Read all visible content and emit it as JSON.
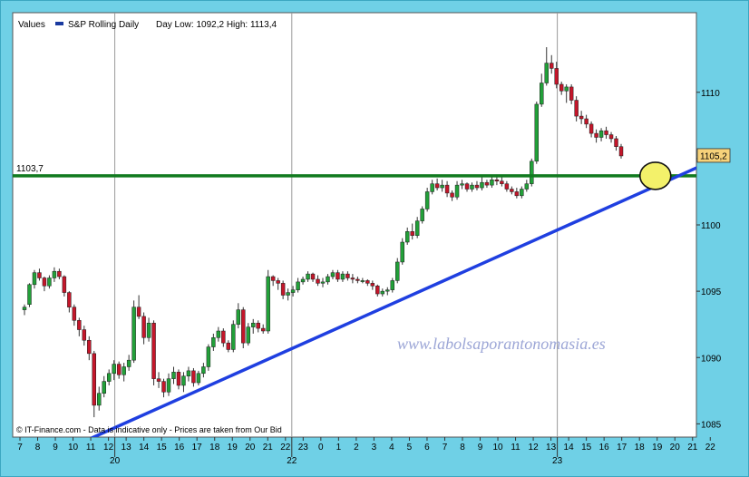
{
  "legend": {
    "values_label": "Values",
    "series_label": "S&P Rolling Daily",
    "range_text": "Day Low: 1092,2 High: 1113,4"
  },
  "footer": {
    "text": "© IT-Finance.com - Data is indicative only - Prices are taken from Our Bid"
  },
  "watermark": "www.labolsaporantonomasia.es",
  "colors": {
    "frame": "#6fd0e6",
    "plot_bg": "#ffffff",
    "up": "#22a039",
    "down": "#c4162a",
    "support_line": "#117a1f",
    "trend_line": "#1f3fe0",
    "price_box": "#f7d27a",
    "highlight": "#f3f16a",
    "watermark": "#9ca6d6"
  },
  "chart_data": {
    "type": "candlestick",
    "title": "S&P Rolling Daily",
    "day_low": "1092,2",
    "day_high": "1113,4",
    "y_ticks": [
      1085,
      1090,
      1095,
      1100,
      1105,
      1110
    ],
    "ylim": [
      1084,
      1116
    ],
    "x_hour_labels": [
      "7",
      "8",
      "9",
      "10",
      "11",
      "12",
      "13",
      "14",
      "15",
      "16",
      "17",
      "18",
      "19",
      "20",
      "21",
      "22",
      "23",
      "0",
      "1",
      "2",
      "3",
      "4",
      "5",
      "6",
      "7",
      "8",
      "9",
      "10",
      "11",
      "12",
      "13",
      "14",
      "15",
      "16",
      "17",
      "18",
      "19",
      "20",
      "21",
      "22"
    ],
    "x_date_labels": [
      {
        "text": "20",
        "after_hour_index": 5
      },
      {
        "text": "22",
        "after_hour_index": 15
      },
      {
        "text": "23",
        "after_hour_index": 30
      }
    ],
    "reference_line": {
      "value": 1103.7,
      "label": "1103,7"
    },
    "last_price": {
      "value": 1105.2,
      "label": "1105,2"
    },
    "trend_line": {
      "start": {
        "hour_index": 4.0,
        "value": 1083.9
      },
      "end": {
        "hour_index": 40.4,
        "value": 1105.6
      }
    },
    "highlight_circle": {
      "hour_index": 35.9,
      "value": 1103.7
    },
    "candles": [
      [
        1093.6,
        1094.0,
        1093.2,
        1093.8
      ],
      [
        1094.0,
        1095.6,
        1093.8,
        1095.5
      ],
      [
        1095.5,
        1096.6,
        1095.2,
        1096.4
      ],
      [
        1096.4,
        1096.7,
        1095.8,
        1096.0
      ],
      [
        1096.0,
        1096.1,
        1095.0,
        1095.4
      ],
      [
        1095.4,
        1096.2,
        1095.2,
        1096.0
      ],
      [
        1096.0,
        1096.8,
        1095.7,
        1096.5
      ],
      [
        1096.5,
        1096.7,
        1095.9,
        1096.1
      ],
      [
        1096.1,
        1096.2,
        1094.6,
        1094.9
      ],
      [
        1094.9,
        1095.0,
        1093.4,
        1093.8
      ],
      [
        1093.8,
        1094.0,
        1092.4,
        1092.8
      ],
      [
        1092.8,
        1093.0,
        1091.6,
        1092.1
      ],
      [
        1092.1,
        1092.4,
        1090.9,
        1091.3
      ],
      [
        1091.3,
        1091.6,
        1089.8,
        1090.3
      ],
      [
        1090.3,
        1090.5,
        1085.5,
        1086.4
      ],
      [
        1086.4,
        1087.8,
        1086.0,
        1087.3
      ],
      [
        1087.3,
        1088.6,
        1087.0,
        1088.2
      ],
      [
        1088.2,
        1089.1,
        1087.9,
        1088.8
      ],
      [
        1088.8,
        1089.8,
        1088.3,
        1089.5
      ],
      [
        1089.5,
        1089.7,
        1088.4,
        1088.7
      ],
      [
        1088.7,
        1089.6,
        1088.2,
        1089.3
      ],
      [
        1089.3,
        1090.2,
        1089.0,
        1089.8
      ],
      [
        1089.8,
        1094.3,
        1089.6,
        1093.8
      ],
      [
        1093.8,
        1094.7,
        1092.9,
        1093.1
      ],
      [
        1093.1,
        1093.4,
        1091.0,
        1091.5
      ],
      [
        1091.5,
        1093.0,
        1091.2,
        1092.6
      ],
      [
        1092.6,
        1092.8,
        1087.9,
        1088.4
      ],
      [
        1088.4,
        1088.9,
        1087.7,
        1088.2
      ],
      [
        1088.2,
        1088.4,
        1087.0,
        1087.4
      ],
      [
        1087.4,
        1088.8,
        1087.1,
        1088.4
      ],
      [
        1088.4,
        1089.3,
        1088.0,
        1088.9
      ],
      [
        1088.9,
        1089.1,
        1087.6,
        1087.9
      ],
      [
        1087.9,
        1088.9,
        1087.4,
        1088.6
      ],
      [
        1088.6,
        1089.3,
        1088.2,
        1089.0
      ],
      [
        1089.0,
        1089.2,
        1087.8,
        1088.1
      ],
      [
        1088.1,
        1089.0,
        1087.9,
        1088.8
      ],
      [
        1088.8,
        1089.6,
        1088.5,
        1089.3
      ],
      [
        1089.3,
        1091.0,
        1089.0,
        1090.8
      ],
      [
        1090.8,
        1091.8,
        1090.5,
        1091.5
      ],
      [
        1091.5,
        1092.3,
        1091.2,
        1092.0
      ],
      [
        1092.0,
        1092.2,
        1090.8,
        1091.1
      ],
      [
        1091.1,
        1091.3,
        1090.4,
        1090.6
      ],
      [
        1090.6,
        1092.8,
        1090.4,
        1092.5
      ],
      [
        1092.5,
        1094.1,
        1092.2,
        1093.6
      ],
      [
        1093.6,
        1093.8,
        1090.7,
        1091.1
      ],
      [
        1091.1,
        1092.6,
        1090.9,
        1092.3
      ],
      [
        1092.3,
        1092.9,
        1091.8,
        1092.6
      ],
      [
        1092.6,
        1092.8,
        1091.9,
        1092.2
      ],
      [
        1092.2,
        1092.5,
        1091.8,
        1092.0
      ],
      [
        1092.0,
        1096.6,
        1091.8,
        1096.1
      ],
      [
        1096.1,
        1096.2,
        1095.4,
        1095.8
      ],
      [
        1095.8,
        1096.0,
        1095.1,
        1095.6
      ],
      [
        1095.6,
        1095.8,
        1094.4,
        1094.7
      ],
      [
        1094.7,
        1095.2,
        1094.3,
        1094.9
      ],
      [
        1094.9,
        1095.4,
        1094.6,
        1095.1
      ],
      [
        1095.1,
        1096.0,
        1094.9,
        1095.7
      ],
      [
        1095.7,
        1096.1,
        1095.5,
        1095.9
      ],
      [
        1095.9,
        1096.5,
        1095.7,
        1096.3
      ],
      [
        1096.3,
        1096.4,
        1095.7,
        1095.9
      ],
      [
        1095.9,
        1096.2,
        1095.4,
        1095.6
      ],
      [
        1095.6,
        1096.0,
        1095.3,
        1095.7
      ],
      [
        1095.7,
        1096.3,
        1095.5,
        1096.1
      ],
      [
        1096.1,
        1096.6,
        1095.9,
        1096.4
      ],
      [
        1096.4,
        1096.6,
        1095.7,
        1095.9
      ],
      [
        1095.9,
        1096.5,
        1095.7,
        1096.3
      ],
      [
        1096.3,
        1096.5,
        1095.8,
        1096.0
      ],
      [
        1096.0,
        1096.3,
        1095.6,
        1095.9
      ],
      [
        1095.9,
        1096.1,
        1095.6,
        1095.8
      ],
      [
        1095.8,
        1096.0,
        1095.6,
        1095.8
      ],
      [
        1095.8,
        1095.9,
        1095.4,
        1095.6
      ],
      [
        1095.6,
        1095.8,
        1095.1,
        1095.4
      ],
      [
        1095.4,
        1095.5,
        1094.6,
        1094.8
      ],
      [
        1094.8,
        1095.2,
        1094.6,
        1095.0
      ],
      [
        1095.0,
        1095.3,
        1094.7,
        1095.1
      ],
      [
        1095.1,
        1096.0,
        1094.9,
        1095.8
      ],
      [
        1095.8,
        1097.5,
        1095.6,
        1097.2
      ],
      [
        1097.2,
        1099.0,
        1097.0,
        1098.7
      ],
      [
        1098.7,
        1099.8,
        1098.5,
        1099.5
      ],
      [
        1099.5,
        1100.1,
        1098.9,
        1099.2
      ],
      [
        1099.2,
        1100.6,
        1099.0,
        1100.3
      ],
      [
        1100.3,
        1101.4,
        1100.1,
        1101.2
      ],
      [
        1101.2,
        1102.8,
        1101.0,
        1102.5
      ],
      [
        1102.5,
        1103.4,
        1102.3,
        1103.1
      ],
      [
        1103.1,
        1103.5,
        1102.6,
        1102.8
      ],
      [
        1102.8,
        1103.4,
        1102.5,
        1103.0
      ],
      [
        1103.0,
        1103.3,
        1102.1,
        1102.4
      ],
      [
        1102.4,
        1102.6,
        1101.8,
        1102.1
      ],
      [
        1102.1,
        1103.3,
        1101.9,
        1103.0
      ],
      [
        1103.0,
        1103.4,
        1102.7,
        1103.1
      ],
      [
        1103.1,
        1103.2,
        1102.5,
        1102.7
      ],
      [
        1102.7,
        1103.2,
        1102.5,
        1103.0
      ],
      [
        1103.0,
        1103.3,
        1102.6,
        1102.8
      ],
      [
        1102.8,
        1103.6,
        1102.6,
        1103.2
      ],
      [
        1103.2,
        1103.4,
        1102.8,
        1103.0
      ],
      [
        1103.0,
        1103.6,
        1102.8,
        1103.4
      ],
      [
        1103.4,
        1103.8,
        1103.0,
        1103.3
      ],
      [
        1103.3,
        1103.6,
        1102.9,
        1103.1
      ],
      [
        1103.1,
        1103.3,
        1102.5,
        1102.7
      ],
      [
        1102.7,
        1102.9,
        1102.3,
        1102.5
      ],
      [
        1102.5,
        1102.8,
        1102.0,
        1102.2
      ],
      [
        1102.2,
        1102.9,
        1102.0,
        1102.7
      ],
      [
        1102.7,
        1103.4,
        1102.5,
        1103.1
      ],
      [
        1103.1,
        1105.0,
        1102.9,
        1104.8
      ],
      [
        1104.8,
        1109.3,
        1104.6,
        1109.1
      ],
      [
        1109.1,
        1111.4,
        1108.9,
        1110.7
      ],
      [
        1110.7,
        1113.4,
        1110.5,
        1112.2
      ],
      [
        1112.2,
        1112.8,
        1111.4,
        1111.8
      ],
      [
        1111.8,
        1112.3,
        1110.3,
        1110.6
      ],
      [
        1110.6,
        1110.8,
        1109.8,
        1110.1
      ],
      [
        1110.1,
        1110.6,
        1109.2,
        1110.4
      ],
      [
        1110.4,
        1110.6,
        1109.1,
        1109.4
      ],
      [
        1109.4,
        1109.7,
        1107.8,
        1108.2
      ],
      [
        1108.2,
        1108.6,
        1107.6,
        1108.0
      ],
      [
        1108.0,
        1108.3,
        1107.3,
        1107.6
      ],
      [
        1107.6,
        1107.8,
        1106.6,
        1106.9
      ],
      [
        1106.9,
        1107.2,
        1106.2,
        1106.6
      ],
      [
        1106.6,
        1107.3,
        1106.3,
        1107.1
      ],
      [
        1107.1,
        1107.4,
        1106.5,
        1106.8
      ],
      [
        1106.8,
        1107.0,
        1106.2,
        1106.5
      ],
      [
        1106.5,
        1106.7,
        1105.6,
        1105.9
      ],
      [
        1105.9,
        1106.1,
        1105.0,
        1105.2
      ]
    ]
  }
}
